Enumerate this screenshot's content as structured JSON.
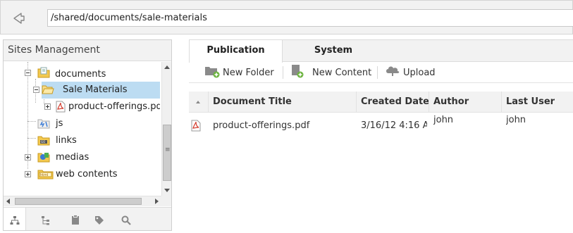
{
  "address_bar": {
    "path": "/shared/documents/sale-materials"
  },
  "left_panel": {
    "title": "Sites Management",
    "tree": [
      {
        "label": "documents",
        "icon": "folder-docs-icon",
        "toggle": "minus",
        "level": 0
      },
      {
        "label": "Sale Materials",
        "icon": "folder-open-icon",
        "toggle": "minus",
        "level": 1,
        "selected": true
      },
      {
        "label": "product-offerings.pdf",
        "icon": "pdf-icon",
        "toggle": "plus",
        "level": 2
      },
      {
        "label": "js",
        "icon": "js-folder-icon",
        "toggle": "none",
        "level": 0
      },
      {
        "label": "links",
        "icon": "links-folder-icon",
        "toggle": "none",
        "level": 0
      },
      {
        "label": "medias",
        "icon": "medias-folder-icon",
        "toggle": "plus",
        "level": 0
      },
      {
        "label": "web contents",
        "icon": "html-folder-icon",
        "toggle": "plus",
        "level": 0
      }
    ],
    "bottom_tabs": [
      "sitemap-icon",
      "hierarchy-icon",
      "clipboard-icon",
      "tag-icon",
      "search-icon"
    ]
  },
  "right_panel": {
    "tabs": [
      {
        "label": "Publication",
        "active": true
      },
      {
        "label": "System",
        "active": false
      }
    ],
    "toolbar": {
      "new_folder": "New Folder",
      "new_content": "New Content",
      "upload": "Upload"
    },
    "table": {
      "columns": [
        "Document Title",
        "Created Date",
        "Author",
        "Last User"
      ],
      "rows": [
        {
          "title": "product-offerings.pdf",
          "created": "3/16/12 4:16 A",
          "author": "john",
          "last_user": "john"
        }
      ]
    }
  },
  "colors": {
    "selection": "#bcdcf2",
    "panel_bg": "#f2f2f2",
    "border": "#d4d4d4",
    "pdf_red": "#d33b2c",
    "folder_yellow": "#f3c94f",
    "add_green": "#6cb33f"
  }
}
